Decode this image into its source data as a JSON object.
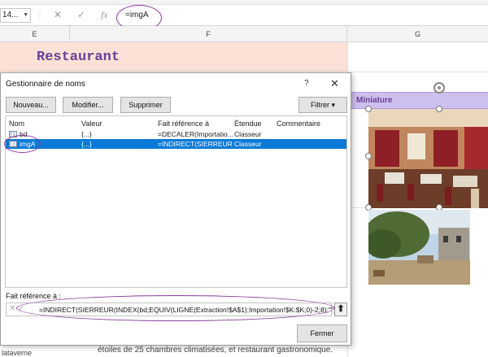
{
  "formula_bar": {
    "namebox_value": "14...",
    "cancel_glyph": "✕",
    "enter_glyph": "✓",
    "fx_label": "fx",
    "formula": "=imgA"
  },
  "columns": [
    "E",
    "F",
    "G"
  ],
  "sheet": {
    "title": "Restaurant",
    "miniature_label": "Miniature",
    "bottom_text": "étoiles de 25 chambres climatisées, et restaurant gastronomique.",
    "bottom_left_text": "lataverne"
  },
  "dialog": {
    "title": "Gestionnaire de noms",
    "help": "?",
    "close": "✕",
    "buttons": {
      "new": "Nouveau...",
      "edit": "Modifier...",
      "delete": "Supprimer",
      "filter": "Filtrer ▾"
    },
    "headers": [
      "Nom",
      "Valeur",
      "Fait référence à",
      "Étendue",
      "Commentaire"
    ],
    "rows": [
      {
        "name": "bd",
        "value": "{...}",
        "refers": "=DECALER(Importatio...",
        "scope": "Classeur",
        "comment": ""
      },
      {
        "name": "imgA",
        "value": "{...}",
        "refers": "=INDIRECT(SIERREUR(...",
        "scope": "Classeur",
        "comment": ""
      }
    ],
    "refers_label": "Fait référence à :",
    "refers_formula": "=INDIRECT(SIERREUR(INDEX(bd;EQUIV(LIGNE(Extraction!$A$1);Importation!$K:$K;0)-2;8);\"\"))",
    "collapse_glyph": "⬆",
    "close_button": "Fermer"
  },
  "colors": {
    "accent_purple": "#6a3f93",
    "selection_blue": "#0a7ad6",
    "title_fill": "#fbe1d6",
    "miniature_fill": "#cdc0ee"
  }
}
